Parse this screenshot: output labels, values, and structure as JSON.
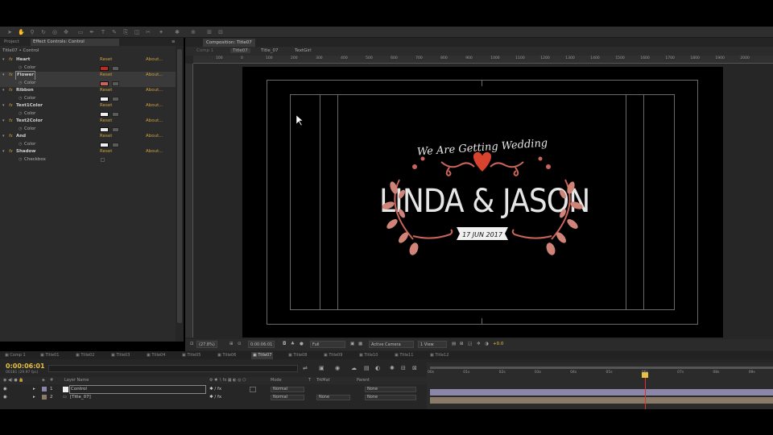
{
  "colors": {
    "accent_timecode": "#e8c040",
    "heart_red": "#d8432e",
    "leaf_pink": "#d08478",
    "text_white": "#e6e6e6"
  },
  "left_panel": {
    "tabs": [
      "Project",
      "Effect Controls: Control"
    ],
    "title": "Title07 • Control",
    "effects": [
      {
        "name": "Heart",
        "reset": "Reset",
        "about": "About...",
        "param": "Color",
        "color": "#c0281e"
      },
      {
        "name": "Flower",
        "reset": "Reset",
        "about": "About...",
        "param": "Color",
        "color": "#c9645a"
      },
      {
        "name": "Ribbon",
        "reset": "Reset",
        "about": "About...",
        "param": "Color",
        "color": "#f0f0f0"
      },
      {
        "name": "Text1Color",
        "reset": "Reset",
        "about": "About...",
        "param": "Color",
        "color": "#f0f0f0"
      },
      {
        "name": "Text2Color",
        "reset": "Reset",
        "about": "About...",
        "param": "Color",
        "color": "#e8e8e8"
      },
      {
        "name": "And",
        "reset": "Reset",
        "about": "About...",
        "param": "Color",
        "color": "#f0f0f0"
      },
      {
        "name": "Shadow",
        "reset": "Reset",
        "about": "About...",
        "param": "Checkbox",
        "color": null
      }
    ]
  },
  "composition": {
    "tab_label": "Composition: Title07",
    "crumbs": [
      "Comp 1",
      "Title07",
      "Title_07",
      "TextGirl"
    ],
    "ruler_ticks": [
      "100",
      "0",
      "100",
      "200",
      "300",
      "400",
      "500",
      "600",
      "700",
      "800",
      "900",
      "1000",
      "1100",
      "1200",
      "1300",
      "1400",
      "1500",
      "1600",
      "1700",
      "1800",
      "1900",
      "2000"
    ],
    "title_top": "We Are Getting Wedding",
    "names": "LINDA & JASON",
    "date": "17 JUN 2017",
    "bottom_bar": {
      "zoom": "(27.8%)",
      "timecode": "0:00:06:01",
      "resolution": "Full",
      "camera": "Active Camera",
      "views": "1 View",
      "exposure": "+0.0"
    }
  },
  "timeline": {
    "tabs": [
      "Comp 1",
      "Title01",
      "Title02",
      "Title03",
      "Title04",
      "Title05",
      "Title06",
      "Title07",
      "Title08",
      "Title09",
      "Title10",
      "Title11",
      "Title12"
    ],
    "active_tab": "Title07",
    "timecode": "0:00:06:01",
    "fps": "00181 (29.97 fps)",
    "columns": {
      "layer_name": "Layer Name",
      "mode": "Mode",
      "trkmat": "TrkMat",
      "parent": "Parent",
      "hash": "#"
    },
    "layers": [
      {
        "num": "1",
        "name": "Control",
        "mode": "Normal",
        "trkmat": "",
        "parent": "None",
        "bar_color": "#8c86a8"
      },
      {
        "num": "2",
        "name": "[Title_07]",
        "mode": "Normal",
        "trkmat": "None",
        "parent": "None",
        "bar_color": "#8a7a68"
      }
    ],
    "ruler": [
      "00s",
      "01s",
      "02s",
      "03s",
      "04s",
      "05s",
      "06s",
      "07s",
      "08s",
      "09s"
    ],
    "playhead_seconds": 6.03
  }
}
